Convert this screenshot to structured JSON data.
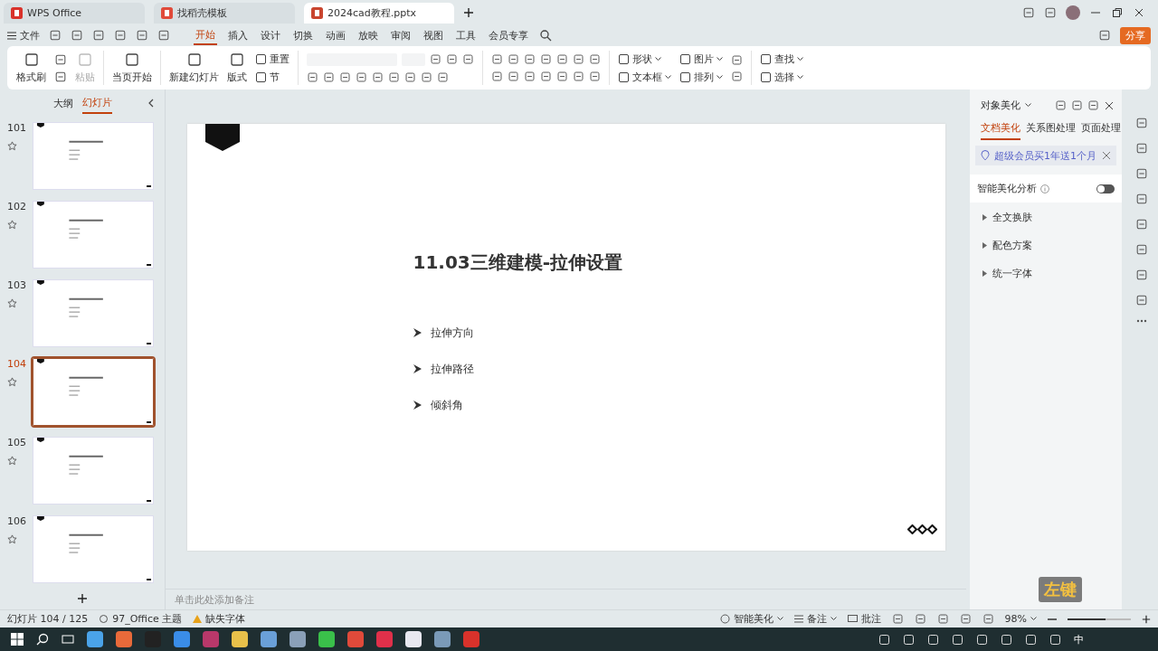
{
  "tabs": [
    {
      "label": "WPS Office",
      "kind": "wps",
      "selected": false
    },
    {
      "label": "找稻壳模板",
      "kind": "template",
      "selected": false
    },
    {
      "label": "2024cad教程.pptx",
      "kind": "doc",
      "selected": true
    }
  ],
  "file_menu": "文件",
  "menu_tabs": [
    {
      "label": "开始",
      "selected": true
    },
    {
      "label": "插入",
      "selected": false
    },
    {
      "label": "设计",
      "selected": false
    },
    {
      "label": "切换",
      "selected": false
    },
    {
      "label": "动画",
      "selected": false
    },
    {
      "label": "放映",
      "selected": false
    },
    {
      "label": "审阅",
      "selected": false
    },
    {
      "label": "视图",
      "selected": false
    },
    {
      "label": "工具",
      "selected": false
    },
    {
      "label": "会员专享",
      "selected": false
    }
  ],
  "share_button": "分享",
  "ribbon": {
    "big": [
      {
        "label": "格式刷",
        "disabled": false
      },
      {
        "label": "粘贴",
        "disabled": true
      },
      {
        "label": "当页开始",
        "disabled": false
      },
      {
        "label": "新建幻灯片",
        "disabled": false
      },
      {
        "label": "版式",
        "disabled": false
      }
    ],
    "small": [
      {
        "label": "重置",
        "disabled": false
      },
      {
        "label": "节",
        "disabled": false
      },
      {
        "label": "形状",
        "disabled": false
      },
      {
        "label": "文本框",
        "disabled": false
      },
      {
        "label": "图片",
        "disabled": false
      },
      {
        "label": "排列",
        "disabled": false
      },
      {
        "label": "查找",
        "disabled": false
      },
      {
        "label": "选择",
        "disabled": false
      }
    ]
  },
  "left_panel": {
    "tabs": [
      {
        "label": "大纲",
        "selected": false
      },
      {
        "label": "幻灯片",
        "selected": true
      }
    ],
    "slides": [
      {
        "number": "101",
        "selected": false
      },
      {
        "number": "102",
        "selected": false
      },
      {
        "number": "103",
        "selected": false
      },
      {
        "number": "104",
        "selected": true
      },
      {
        "number": "105",
        "selected": false
      },
      {
        "number": "106",
        "selected": false
      }
    ]
  },
  "slide": {
    "title": "11.03三维建模-拉伸设置",
    "bullets": [
      "拉伸方向",
      "拉伸路径",
      "倾斜角"
    ]
  },
  "notes": {
    "placeholder": "单击此处添加备注"
  },
  "right_panel": {
    "title": "对象美化",
    "tabs": [
      {
        "label": "文档美化",
        "selected": true
      },
      {
        "label": "关系图处理",
        "selected": false
      },
      {
        "label": "页面处理",
        "selected": false
      }
    ],
    "promo": "超级会员买1年送1个月",
    "toggle": {
      "label": "智能美化分析",
      "on": false
    },
    "sections": [
      "全文换肤",
      "配色方案",
      "统一字体"
    ]
  },
  "key_hint": "左键",
  "status_bar": {
    "slide_count": "幻灯片 104 / 125",
    "theme": "97_Office 主题",
    "missing_font": "缺失字体",
    "beautify": "智能美化",
    "notes": "备注",
    "comments": "批注",
    "zoom": "98%",
    "zoom_level": {
      "level": 0.6
    }
  },
  "taskbar": {
    "ime": "中"
  }
}
